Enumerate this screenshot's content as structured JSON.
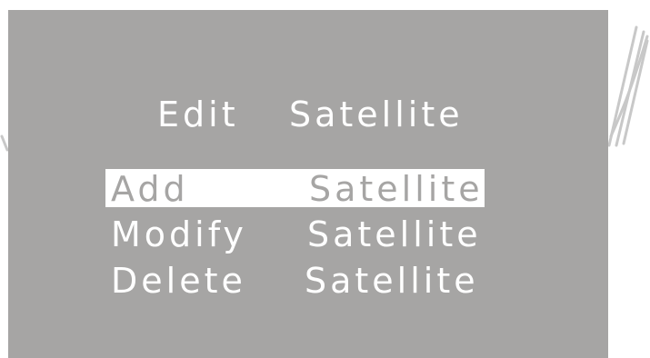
{
  "colors": {
    "panel_background": "#a6a5a4",
    "text": "#ffffff",
    "selection_highlight": "#ffffff",
    "selected_text": "#a6a5a4"
  },
  "menu": {
    "title_word1": "Edit",
    "title_word2": "Satellite",
    "selected_index": 0,
    "items": [
      {
        "action": "Add",
        "target": "Satellite"
      },
      {
        "action": "Modify",
        "target": "Satellite"
      },
      {
        "action": "Delete",
        "target": "Satellite"
      }
    ]
  }
}
